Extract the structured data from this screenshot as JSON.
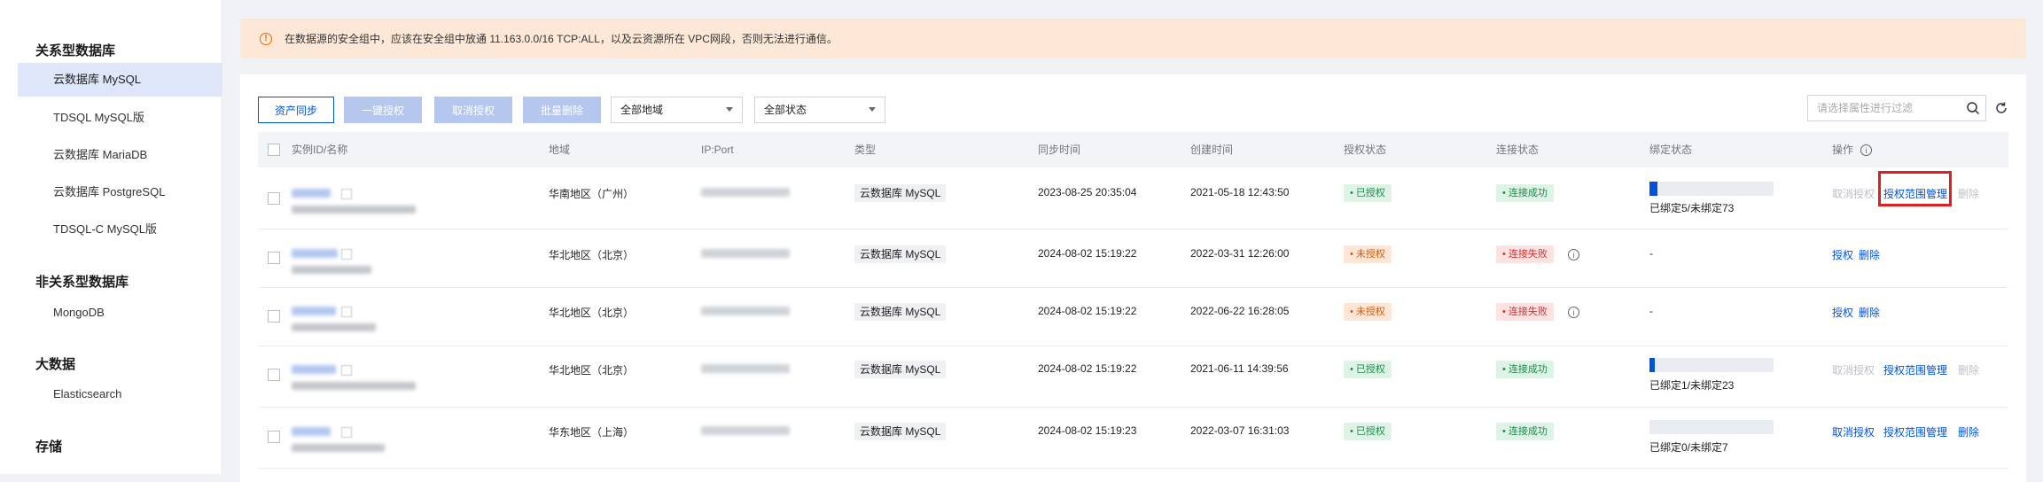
{
  "sidebar": {
    "groups": [
      {
        "title": "关系型数据库",
        "items": [
          "云数据库 MySQL",
          "TDSQL MySQL版",
          "云数据库 MariaDB",
          "云数据库 PostgreSQL",
          "TDSQL-C MySQL版"
        ]
      },
      {
        "title": "非关系型数据库",
        "items": [
          "MongoDB"
        ]
      },
      {
        "title": "大数据",
        "items": [
          "Elasticsearch"
        ]
      },
      {
        "title": "存储",
        "items": []
      }
    ],
    "active_item": "云数据库 MySQL"
  },
  "banner": {
    "text": "在数据源的安全组中，应该在安全组中放通 11.163.0.0/16 TCP:ALL，以及云资源所在 VPC网段，否则无法进行通信。",
    "icon": "warning-circle-icon"
  },
  "toolbar": {
    "sync_label": "资产同步",
    "one_key_auth_label": "一键授权",
    "cancel_auth_label": "取消授权",
    "batch_delete_label": "批量删除",
    "region_select": "全部地域",
    "status_select": "全部状态",
    "search_placeholder": "请选择属性进行过滤"
  },
  "table": {
    "headers": {
      "id": "实例ID/名称",
      "region": "地域",
      "ipport": "IP:Port",
      "type": "类型",
      "sync": "同步时间",
      "created": "创建时间",
      "auth": "授权状态",
      "conn": "连接状态",
      "bind": "绑定状态",
      "ops": "操作"
    },
    "rows": [
      {
        "region": "华南地区（广州）",
        "type": "云数据库 MySQL",
        "sync": "2023-08-25 20:35:04",
        "created": "2021-05-18 12:43:50",
        "auth": "已授权",
        "conn": "连接成功",
        "bind_text": "已绑定5/未绑定73",
        "bind_fraction": 0.064,
        "ops": [
          "取消授权",
          "授权范围管理",
          "删除"
        ]
      },
      {
        "region": "华北地区（北京）",
        "type": "云数据库 MySQL",
        "sync": "2024-08-02 15:19:22",
        "created": "2022-03-31 12:26:00",
        "auth": "未授权",
        "conn": "连接失败",
        "bind_text": "-",
        "ops": [
          "授权",
          "删除"
        ]
      },
      {
        "region": "华北地区（北京）",
        "type": "云数据库 MySQL",
        "sync": "2024-08-02 15:19:22",
        "created": "2022-06-22 16:28:05",
        "auth": "未授权",
        "conn": "连接失败",
        "bind_text": "-",
        "ops": [
          "授权",
          "删除"
        ]
      },
      {
        "region": "华北地区（北京）",
        "type": "云数据库 MySQL",
        "sync": "2024-08-02 15:19:22",
        "created": "2021-06-11 14:39:56",
        "auth": "已授权",
        "conn": "连接成功",
        "bind_text": "已绑定1/未绑定23",
        "bind_fraction": 0.042,
        "ops": [
          "取消授权",
          "授权范围管理",
          "删除"
        ]
      },
      {
        "region": "华东地区（上海）",
        "type": "云数据库 MySQL",
        "sync": "2024-08-02 15:19:23",
        "created": "2022-03-07 16:31:03",
        "auth": "已授权",
        "conn": "连接成功",
        "bind_text": "已绑定0/未绑定7",
        "bind_fraction": 0,
        "ops": [
          "取消授权",
          "授权范围管理",
          "删除"
        ]
      }
    ]
  },
  "colors": {
    "accent": "#0052d9",
    "success": "#1f8a4c",
    "warning": "#d4590a",
    "danger": "#d42f2f",
    "highlight": "#e02020"
  }
}
